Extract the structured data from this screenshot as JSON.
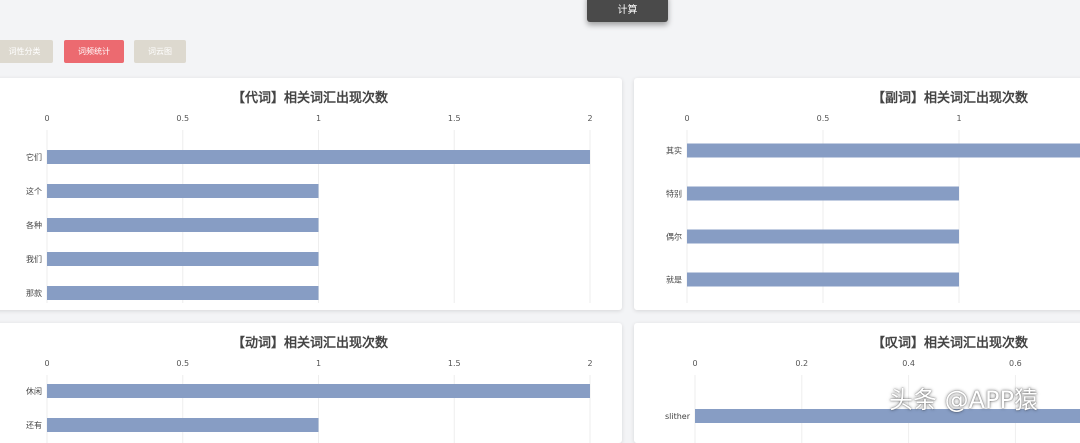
{
  "toolbar": {
    "calc_label": "计算"
  },
  "tabs": [
    {
      "label": "词性分类"
    },
    {
      "label": "词频统计"
    },
    {
      "label": "词云图"
    }
  ],
  "colors": {
    "bar": "#879dc4",
    "active_tab": "#ec6a70",
    "inactive_tab": "#ddd9cf",
    "calc_button": "#4a4a4a"
  },
  "chart_data": [
    {
      "type": "bar",
      "orientation": "horizontal",
      "title": "【代词】相关词汇出现次数",
      "categories": [
        "它们",
        "这个",
        "各种",
        "我们",
        "那款"
      ],
      "values": [
        2,
        1,
        1,
        1,
        1
      ],
      "xlim": [
        0,
        2
      ],
      "ticks": [
        "0",
        "0.5",
        "1",
        "1.5",
        "2"
      ],
      "grid": true
    },
    {
      "type": "bar",
      "orientation": "horizontal",
      "title": "【副词】相关词汇出现次数",
      "categories": [
        "其实",
        "特别",
        "偶尔",
        "就是"
      ],
      "values": [
        2,
        1,
        1,
        1
      ],
      "xlim": [
        0,
        2
      ],
      "ticks": [
        "0",
        "0.5",
        "1"
      ],
      "grid": true
    },
    {
      "type": "bar",
      "orientation": "horizontal",
      "title": "【动词】相关词汇出现次数",
      "categories": [
        "休闲",
        "还有"
      ],
      "values": [
        2,
        1
      ],
      "xlim": [
        0,
        2
      ],
      "ticks": [
        "0",
        "0.5",
        "1",
        "1.5",
        "2"
      ],
      "grid": true
    },
    {
      "type": "bar",
      "orientation": "horizontal",
      "title": "【叹词】相关词汇出现次数",
      "categories": [
        "slither"
      ],
      "values": [
        1
      ],
      "xlim": [
        0,
        1
      ],
      "ticks": [
        "0",
        "0.2",
        "0.4",
        "0.6"
      ],
      "grid": true
    }
  ],
  "watermark": "头条 @APP猿"
}
